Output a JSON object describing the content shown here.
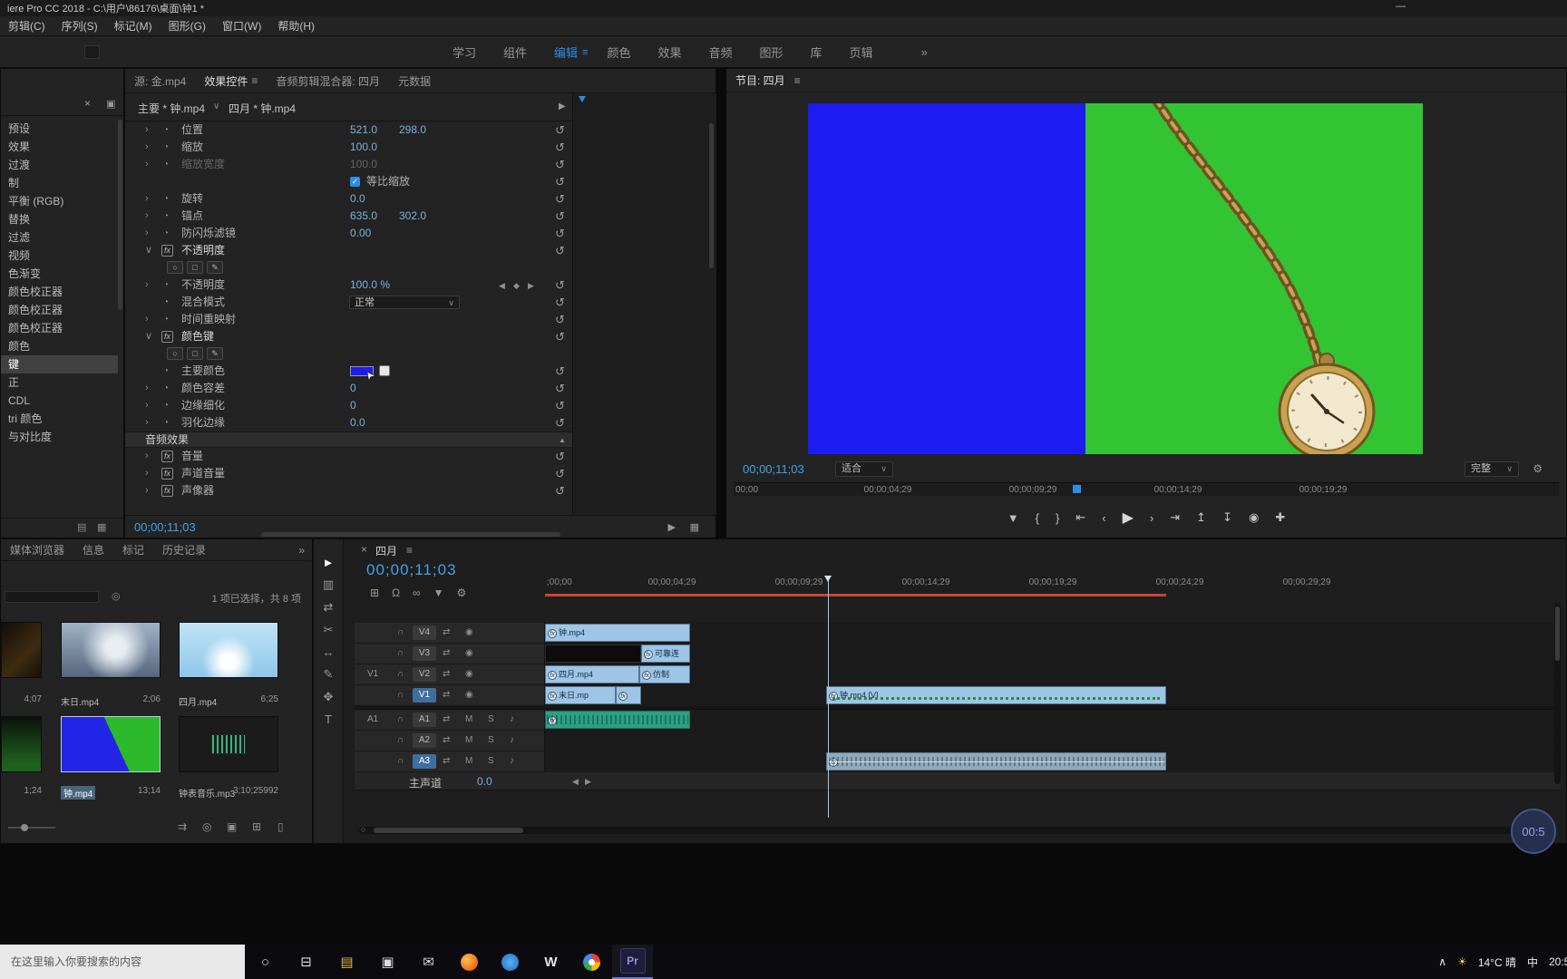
{
  "colors": {
    "accent": "#2d8ceb",
    "hot": "#7bb0de",
    "tc": "#42a0e8",
    "progblue": "#1c1cf0",
    "proggreen": "#33c433",
    "clip": "#9ec5e6",
    "audio1": "#2aa183",
    "audio2": "#8ea9bd",
    "red": "#c94536"
  },
  "icons": {
    "minimize": "—",
    "menu": "≡",
    "close": "×",
    "overflow": "»",
    "caret": "∨",
    "disclosure": "›",
    "expanded": "∨",
    "reset": "↺",
    "stopwatch": "◔",
    "fx": "fx",
    "check": "✓",
    "ellipse": "○",
    "rect": "□",
    "pen": "✎",
    "kf_prev": "◀",
    "kf_add": "◆",
    "kf_next": "▶",
    "play": "▶",
    "step_back": "‹",
    "step_fwd": "›",
    "goto_in": "⇤",
    "goto_out": "⇥",
    "mark_in": "{",
    "mark_out": "}",
    "marker": "▼",
    "lift": "↥",
    "extract": "↧",
    "export_frame": "◉",
    "button_editor": "✚",
    "wrench": "⚙",
    "snap": "Ω",
    "linked": "∞",
    "nest": "⊞",
    "selection": "►",
    "track_select": "▥",
    "ripple": "⇄",
    "razor": "✂",
    "slip": "↔",
    "hand": "✥",
    "type": "T",
    "lock": "∩",
    "sync": "⇄",
    "eye": "◉",
    "mic": "♪",
    "collapse": "▲",
    "view1": "▤",
    "view2": "▦",
    "auto": "⇉",
    "find": "◎",
    "bin": "▣",
    "newitem": "⊞",
    "trash": "▯",
    "cortana": "○",
    "taskview": "⊟",
    "folder": "▤",
    "store": "▣",
    "mail": "✉",
    "up": "∧",
    "sun": "☀",
    "timeline_view": "▶"
  },
  "title_bar": {
    "title": "iere Pro CC 2018 - C:\\用户\\86176\\桌面\\钟1 *"
  },
  "menu": {
    "items": [
      "剪辑(C)",
      "序列(S)",
      "标记(M)",
      "图形(G)",
      "窗口(W)",
      "帮助(H)"
    ]
  },
  "workspace": {
    "tabs": [
      "学习",
      "组件",
      "编辑",
      "颜色",
      "效果",
      "音频",
      "图形",
      "库",
      "页辑"
    ]
  },
  "effects_panel": {
    "items": [
      "预设",
      "效果",
      "过渡",
      "制",
      "平衡 (RGB)",
      "替换",
      "过滤",
      "视频",
      "色渐变",
      "颜色校正器",
      "颜色校正器",
      "颜色校正器",
      "颜色",
      "键",
      "正",
      "CDL",
      "tri 颜色",
      "与对比度"
    ]
  },
  "effect_controls": {
    "tabs": {
      "source": "源: 金.mp4",
      "controls": "效果控件",
      "mixer": "音频剪辑混合器: 四月",
      "metadata": "元数据"
    },
    "header": {
      "master": "主要 * 钟.mp4",
      "clip": "四月 * 钟.mp4"
    },
    "position": {
      "name": "位置",
      "x": "521.0",
      "y": "298.0"
    },
    "scale": {
      "name": "缩放",
      "value": "100.0"
    },
    "scale_width": {
      "name": "缩放宽度",
      "value": "100.0"
    },
    "uniform": {
      "name": "等比缩放"
    },
    "rotation": {
      "name": "旋转",
      "value": "0.0"
    },
    "anchor": {
      "name": "锚点",
      "x": "635.0",
      "y": "302.0"
    },
    "antiflicker": {
      "name": "防闪烁滤镜",
      "value": "0.00"
    },
    "opacity": {
      "section": "不透明度",
      "name": "不透明度",
      "value": "100.0 %",
      "blend": "混合模式",
      "blend_value": "正常"
    },
    "time_remap": {
      "section": "时间重映射"
    },
    "color_key": {
      "section": "颜色键",
      "color": "主要颜色",
      "tolerance": "颜色容差",
      "tolerance_value": "0",
      "edge": "边缘细化",
      "edge_value": "0",
      "feather": "羽化边缘",
      "feather_value": "0.0"
    },
    "audio": {
      "header": "音频效果",
      "volume": "音量",
      "channel_volume": "声道音量",
      "panner": "声像器"
    },
    "timecode": "00;00;11;03"
  },
  "program": {
    "tab": "节目: 四月",
    "timecode": "00;00;11;03",
    "fit": "适合",
    "quality": "完整",
    "ruler": [
      "00;00",
      "00;00;04;29",
      "00;00;09;29",
      "00;00;14;29",
      "00;00;19;29"
    ]
  },
  "project": {
    "tabs": [
      "媒体浏览器",
      "信息",
      "标记",
      "历史记录"
    ],
    "selection": "1 项已选择，共 8 项",
    "items": [
      {
        "name": "",
        "duration": "4;07"
      },
      {
        "name": "末日.mp4",
        "duration": "2;06"
      },
      {
        "name": "四月.mp4",
        "duration": "6;25"
      },
      {
        "name": "",
        "duration": "1;24"
      },
      {
        "name": "钟.mp4",
        "duration": "13;14"
      },
      {
        "name": "钟表音乐.mp3",
        "duration": "3;10;25992"
      }
    ]
  },
  "timeline": {
    "tab": "四月",
    "timecode": "00;00;11;03",
    "ruler": [
      ";00;00",
      "00;00;04;29",
      "00;00;09;29",
      "00;00;14;29",
      "00;00;19;29",
      "00;00;24;29",
      "00;00;29;29"
    ],
    "tracks": {
      "v4": "V4",
      "v3": "V3",
      "v2": "V2",
      "v1": "V1",
      "a1": "A1",
      "a2": "A2",
      "a3": "A3"
    },
    "patch_video": "V1",
    "patch_audio": "A1",
    "mute": "M",
    "solo": "S",
    "master_label": "主声道",
    "master_value": "0.0",
    "clips": {
      "v4": "钟.mp4",
      "v3": "可靠连",
      "v2": "四月.mp4",
      "v2b": "仿制",
      "v1": "末日.mp",
      "v1r": "钟.mp4 [V]"
    }
  },
  "taskbar": {
    "search_placeholder": "在这里输入你要搜索的内容",
    "w_label": "W",
    "pr_label": "Pr",
    "weather": "14°C 晴",
    "ime": "中",
    "time": "20:5"
  },
  "record_badge": "00:5"
}
